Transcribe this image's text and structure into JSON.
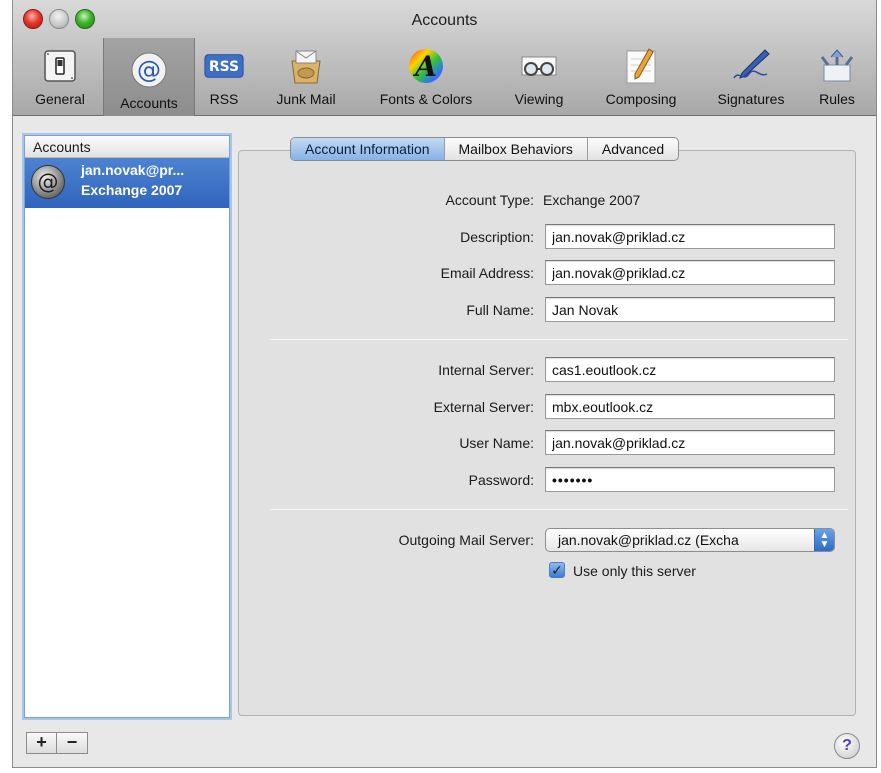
{
  "window": {
    "title": "Accounts"
  },
  "toolbar": {
    "items": [
      {
        "label": "General",
        "icon": "general-switch-icon"
      },
      {
        "label": "Accounts",
        "icon": "at-sign-icon",
        "selected": true
      },
      {
        "label": "RSS",
        "icon": "rss-icon",
        "badge_text": "RSS"
      },
      {
        "label": "Junk Mail",
        "icon": "junk-mail-icon"
      },
      {
        "label": "Fonts & Colors",
        "icon": "fonts-colors-icon",
        "badge_text": "A"
      },
      {
        "label": "Viewing",
        "icon": "viewing-glasses-icon"
      },
      {
        "label": "Composing",
        "icon": "composing-pencil-icon"
      },
      {
        "label": "Signatures",
        "icon": "signature-pen-icon"
      },
      {
        "label": "Rules",
        "icon": "rules-arrows-icon"
      }
    ]
  },
  "sidebar": {
    "header": "Accounts",
    "accounts": [
      {
        "name": "jan.novak@pr...",
        "type": "Exchange 2007",
        "icon": "at-sign-icon",
        "selected": true
      }
    ],
    "add_label": "+",
    "remove_label": "−"
  },
  "tabs": [
    {
      "label": "Account Information",
      "active": true
    },
    {
      "label": "Mailbox Behaviors",
      "active": false
    },
    {
      "label": "Advanced",
      "active": false
    }
  ],
  "form": {
    "account_type_label": "Account Type:",
    "account_type_value": "Exchange 2007",
    "description_label": "Description:",
    "description_value": "jan.novak@priklad.cz",
    "email_label": "Email Address:",
    "email_value": "jan.novak@priklad.cz",
    "fullname_label": "Full Name:",
    "fullname_value": "Jan Novak",
    "internal_server_label": "Internal Server:",
    "internal_server_value": "cas1.eoutlook.cz",
    "external_server_label": "External Server:",
    "external_server_value": "mbx.eoutlook.cz",
    "username_label": "User Name:",
    "username_value": "jan.novak@priklad.cz",
    "password_label": "Password:",
    "password_value": "•••••••",
    "outgoing_label": "Outgoing Mail Server:",
    "outgoing_value": "jan.novak@priklad.cz (Excha",
    "use_only_label": "Use only this server",
    "use_only_checked": true
  },
  "help": {
    "label": "?"
  },
  "colors": {
    "selection_blue": "#3a6fc6",
    "tab_active": "#9fc3ec",
    "window_bg": "#e8e8e8"
  }
}
